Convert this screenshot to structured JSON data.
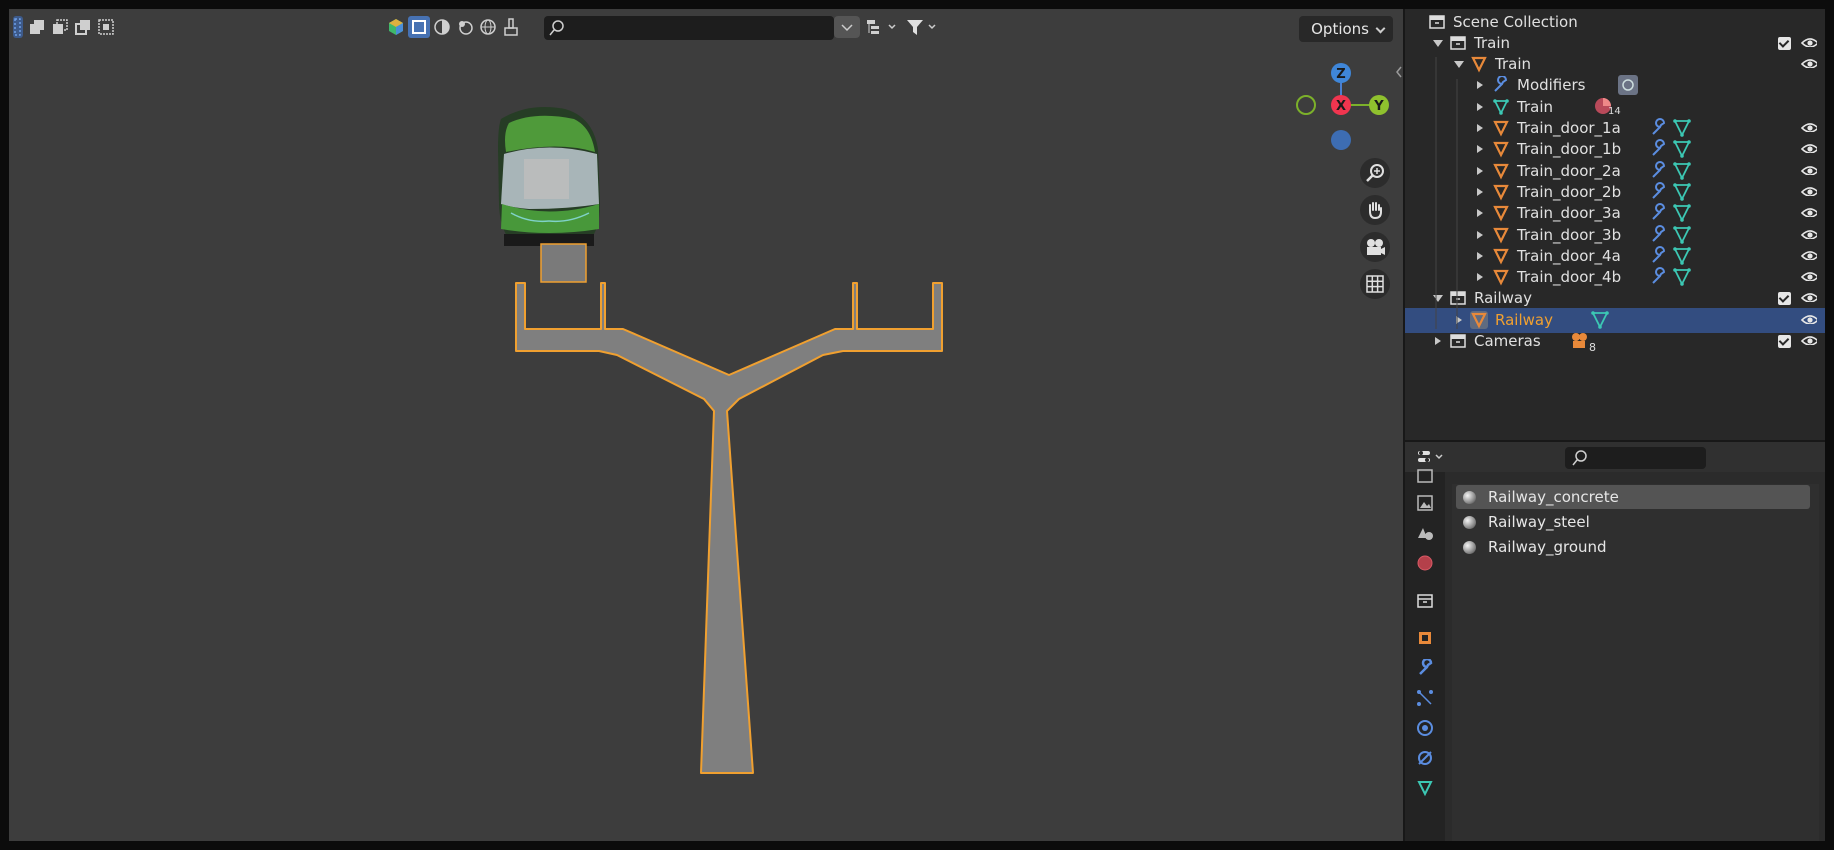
{
  "viewport": {
    "header": {
      "options_label": "Options",
      "search_placeholder": ""
    },
    "gizmo": {
      "z": "Z",
      "x": "X",
      "y": "Y"
    }
  },
  "outliner": {
    "rows": [
      {
        "label": "Scene Collection",
        "icon": "collection-icon",
        "depth": 0
      },
      {
        "label": "Train",
        "icon": "collection-icon",
        "depth": 1,
        "checkbox": true,
        "eye": true
      },
      {
        "label": "Train",
        "icon": "object-icon",
        "depth": 2,
        "eye": true
      },
      {
        "label": "Modifiers",
        "icon": "wrench-icon",
        "depth": 3
      },
      {
        "label": "Train",
        "icon": "mesh-icon",
        "depth": 3,
        "badge": "14"
      },
      {
        "label": "Train_door_1a",
        "icon": "object-icon",
        "depth": 3,
        "eye": true
      },
      {
        "label": "Train_door_1b",
        "icon": "object-icon",
        "depth": 3,
        "eye": true
      },
      {
        "label": "Train_door_2a",
        "icon": "object-icon",
        "depth": 3,
        "eye": true
      },
      {
        "label": "Train_door_2b",
        "icon": "object-icon",
        "depth": 3,
        "eye": true
      },
      {
        "label": "Train_door_3a",
        "icon": "object-icon",
        "depth": 3,
        "eye": true
      },
      {
        "label": "Train_door_3b",
        "icon": "object-icon",
        "depth": 3,
        "eye": true
      },
      {
        "label": "Train_door_4a",
        "icon": "object-icon",
        "depth": 3,
        "eye": true
      },
      {
        "label": "Train_door_4b",
        "icon": "object-icon",
        "depth": 3,
        "eye": true
      },
      {
        "label": "Railway",
        "icon": "collection-icon",
        "depth": 1,
        "checkbox": true,
        "eye": true
      },
      {
        "label": "Railway",
        "icon": "object-icon",
        "depth": 2,
        "eye": true,
        "selected": true
      },
      {
        "label": "Cameras",
        "icon": "collection-icon",
        "depth": 1,
        "checkbox": true,
        "eye": true,
        "badge": "8"
      }
    ]
  },
  "properties": {
    "materials": [
      "Railway_concrete",
      "Railway_steel",
      "Railway_ground"
    ]
  },
  "colors": {
    "selection_outline": "#f0a030",
    "selected_row": "#334d80",
    "object_orange": "#e8893a",
    "mesh_teal": "#3cc8b4",
    "wrench_blue": "#5b8de0"
  }
}
